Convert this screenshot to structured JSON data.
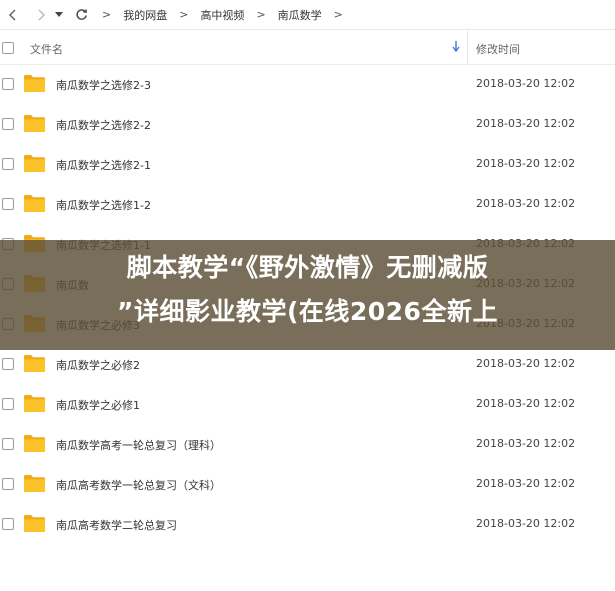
{
  "breadcrumb": [
    "我的网盘",
    "高中视频",
    "南瓜数学"
  ],
  "breadcrumb_separator": ">",
  "header": {
    "name_label": "文件名",
    "time_label": "修改时间"
  },
  "files": [
    {
      "name": "南瓜数学之选修2-3",
      "modified": "2018-03-20 12:02"
    },
    {
      "name": "南瓜数学之选修2-2",
      "modified": "2018-03-20 12:02"
    },
    {
      "name": "南瓜数学之选修2-1",
      "modified": "2018-03-20 12:02"
    },
    {
      "name": "南瓜数学之选修1-2",
      "modified": "2018-03-20 12:02"
    },
    {
      "name": "南瓜数学之选修1-1",
      "modified": "2018-03-20 12:02"
    },
    {
      "name": "南瓜数",
      "modified": "2018-03-20 12:02"
    },
    {
      "name": "南瓜数学之必修3",
      "modified": "2018-03-20 12:02"
    },
    {
      "name": "南瓜数学之必修2",
      "modified": "2018-03-20 12:02"
    },
    {
      "name": "南瓜数学之必修1",
      "modified": "2018-03-20 12:02"
    },
    {
      "name": "南瓜数学高考一轮总复习（理科）",
      "modified": "2018-03-20 12:02"
    },
    {
      "name": "南瓜高考数学一轮总复习（文科）",
      "modified": "2018-03-20 12:02"
    },
    {
      "name": "南瓜高考数学二轮总复习",
      "modified": "2018-03-20 12:02"
    }
  ],
  "banner": {
    "line1": "脚本教学“《野外激情》无删减版",
    "line2": "”详细影业教学(在线2026全新上"
  },
  "colors": {
    "folder": "#fcc22b",
    "folder_tab": "#f0ac14",
    "banner_bg": "#5c4e36",
    "sort_arrow": "#3b7ddd"
  },
  "icons": [
    "back-arrow-icon",
    "forward-arrow-icon",
    "dropdown-caret-icon",
    "refresh-icon",
    "sort-down-arrow-icon",
    "folder-icon"
  ]
}
